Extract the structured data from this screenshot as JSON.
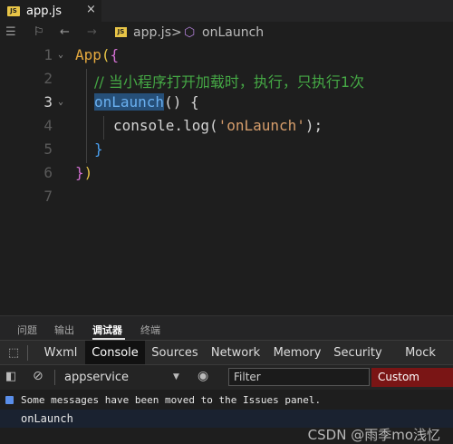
{
  "tab": {
    "badge": "JS",
    "label": "app.js",
    "close": "×"
  },
  "breadcrumb": {
    "file": "app.js",
    "separator": ">",
    "symbol": "onLaunch"
  },
  "editor": {
    "line_numbers": [
      "1",
      "2",
      "3",
      "4",
      "5",
      "6",
      "7"
    ],
    "active_line": "3",
    "lines": {
      "l1_fn": "App",
      "l1_paren": "(",
      "l1_brace": "{",
      "l2_comment": "// 当小程序打开加载时，执行，只执行1次",
      "l3_id": "onLaunch",
      "l3_rest": "() {",
      "l4_console": "console.log(",
      "l4_str": "'onLaunch'",
      "l4_end": ");",
      "l5_close": "}",
      "l6_brace": "}",
      "l6_paren": ")"
    }
  },
  "panel": {
    "tabs": [
      "问题",
      "输出",
      "调试器",
      "终端"
    ],
    "active_tab": "调试器"
  },
  "devtools": {
    "tabs": [
      "Wxml",
      "Console",
      "Sources",
      "Network",
      "Memory",
      "Security",
      "Mock"
    ],
    "active_tab": "Console"
  },
  "filter": {
    "context": "appservice",
    "placeholder": "Filter",
    "levels": "Custom levels ▼"
  },
  "console": {
    "message": "Some messages have been moved to the Issues panel.",
    "log": "onLaunch"
  },
  "watermark": "CSDN @雨季mo浅忆",
  "colors": {
    "accent_levels": "#7a1515",
    "js_badge": "#e8c547",
    "selection": "#264f78"
  }
}
